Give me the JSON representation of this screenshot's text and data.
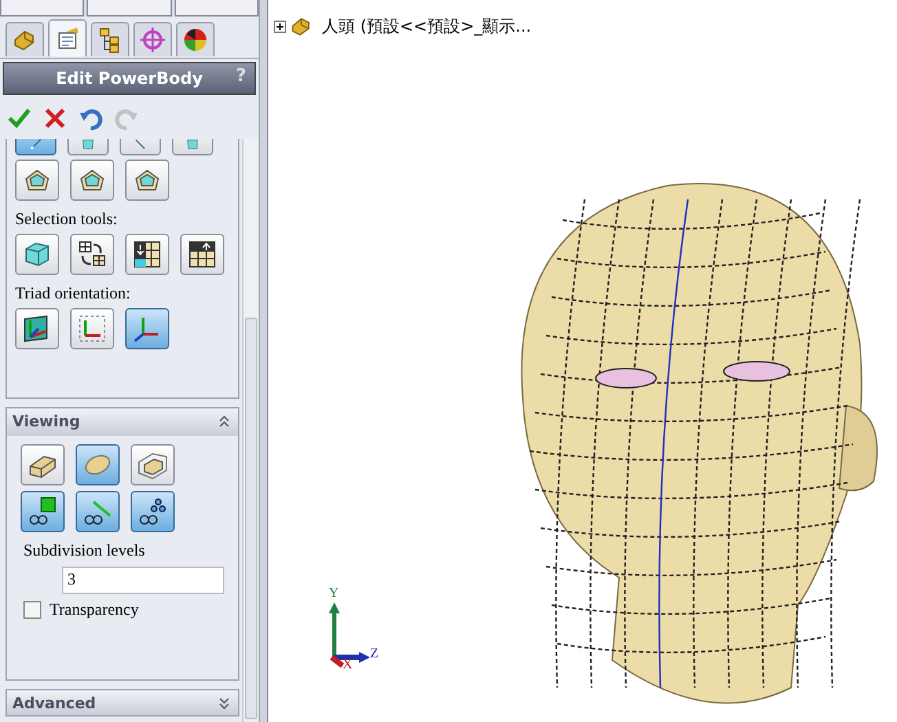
{
  "panel_tabs": [
    {
      "kind": "part",
      "selected": false
    },
    {
      "kind": "property",
      "selected": true
    },
    {
      "kind": "tree",
      "selected": false
    },
    {
      "kind": "target",
      "selected": false
    },
    {
      "kind": "appearance",
      "selected": false
    }
  ],
  "property_manager": {
    "title": "Edit PowerBody",
    "help": "?"
  },
  "actions": [
    {
      "kind": "ok",
      "disabled": false
    },
    {
      "kind": "cancel",
      "disabled": false
    },
    {
      "kind": "undo",
      "disabled": false
    },
    {
      "kind": "redo",
      "disabled": true
    }
  ],
  "tools": {
    "top_row": [
      {
        "kind": "edge",
        "selected": true
      },
      {
        "kind": "face",
        "selected": false
      },
      {
        "kind": "line",
        "selected": false
      },
      {
        "kind": "face",
        "selected": false
      }
    ],
    "shape_row": [
      {
        "kind": "ring",
        "selected": false
      },
      {
        "kind": "ring",
        "selected": false
      },
      {
        "kind": "ring",
        "selected": false
      }
    ],
    "selection_label": "Selection tools:",
    "selection_row": [
      {
        "kind": "cube",
        "selected": false
      },
      {
        "kind": "swap",
        "selected": false
      },
      {
        "kind": "grid-down",
        "selected": false
      },
      {
        "kind": "grid-up",
        "selected": false
      }
    ],
    "triad_label": "Triad orientation:",
    "triad_row": [
      {
        "kind": "triad-plane",
        "selected": false
      },
      {
        "kind": "triad-box",
        "selected": false
      },
      {
        "kind": "triad",
        "selected": true
      }
    ]
  },
  "viewing": {
    "title": "Viewing",
    "expanded": true,
    "mode_row": [
      {
        "kind": "box",
        "selected": false
      },
      {
        "kind": "smooth",
        "selected": true
      },
      {
        "kind": "both",
        "selected": false
      }
    ],
    "display_row": [
      {
        "kind": "glasses-face",
        "selected": true
      },
      {
        "kind": "glasses-edge",
        "selected": true
      },
      {
        "kind": "glasses-point",
        "selected": true
      }
    ],
    "subdivision_label": "Subdivision levels",
    "subdivision_value": "3",
    "transparency": {
      "label": "Transparency",
      "checked": false
    }
  },
  "advanced": {
    "title": "Advanced",
    "expanded": false
  },
  "tree": {
    "label": "人頭 (預設<<預設>_顯示...",
    "expanded": false
  },
  "triad": {
    "y": "Y",
    "x": "X",
    "z": "Z"
  }
}
